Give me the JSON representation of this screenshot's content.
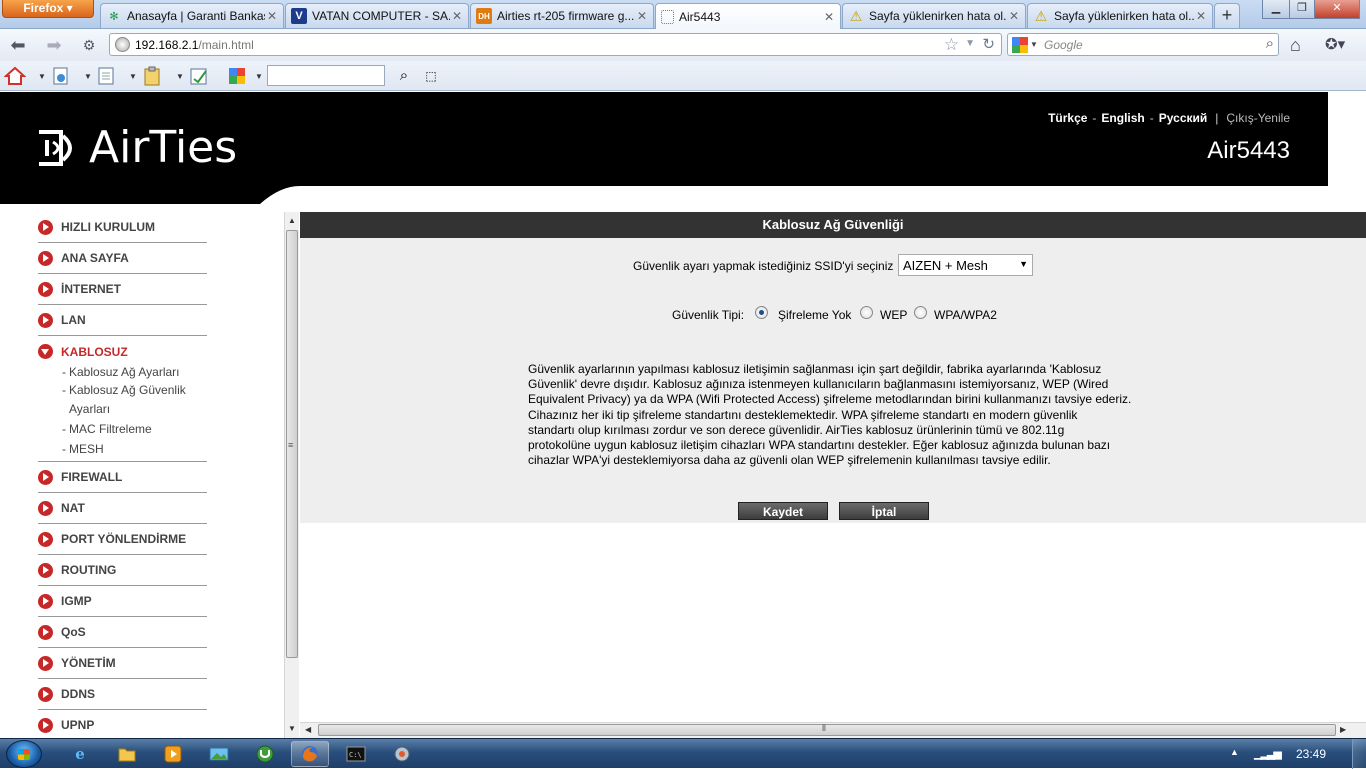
{
  "browser": {
    "app_button": "Firefox",
    "tabs": [
      {
        "title": "Anasayfa | Garanti Bankası",
        "icon": "garanti-icon"
      },
      {
        "title": "VATAN COMPUTER - SA...",
        "icon": "vatan-icon"
      },
      {
        "title": "Airties rt-205 firmware g...",
        "icon": "dh-icon"
      },
      {
        "title": "Air5443",
        "icon": "blank-page-icon",
        "active": true
      },
      {
        "title": "Sayfa yüklenirken hata ol...",
        "icon": "warning-icon"
      },
      {
        "title": "Sayfa yüklenirken hata ol...",
        "icon": "warning-icon"
      }
    ],
    "url_host": "192.168.2.1",
    "url_path": "/main.html",
    "search_placeholder": "Google",
    "icons": {
      "back": "◀",
      "forward": "▶",
      "home": "⌂",
      "bookmarks": "★"
    }
  },
  "header": {
    "logo": "AirTies",
    "lang": {
      "tr": "Türkçe",
      "en": "English",
      "ru": "Русский"
    },
    "sep": "-",
    "bar": "|",
    "logout": "Çıkış",
    "refresh": "Yenile",
    "model": "Air5443"
  },
  "menu": [
    {
      "label": "HIZLI KURULUM"
    },
    {
      "label": "ANA SAYFA"
    },
    {
      "label": "İNTERNET"
    },
    {
      "label": "LAN"
    },
    {
      "label": "KABLOSUZ",
      "active": true
    },
    {
      "label": "FIREWALL"
    },
    {
      "label": "NAT"
    },
    {
      "label": "PORT YÖNLENDİRME"
    },
    {
      "label": "ROUTING"
    },
    {
      "label": "IGMP"
    },
    {
      "label": "QoS"
    },
    {
      "label": "YÖNETİM"
    },
    {
      "label": "DDNS"
    },
    {
      "label": "UPNP"
    }
  ],
  "submenu": [
    {
      "label": "Kablosuz Ağ Ayarları"
    },
    {
      "label": "Kablosuz Ağ Güvenlik Ayarları"
    },
    {
      "label": "MAC Filtreleme"
    },
    {
      "label": "MESH"
    }
  ],
  "content": {
    "title": "Kablosuz Ağ Güvenliği",
    "ssid_label": "Güvenlik ayarı yapmak istediğiniz SSID'yi seçiniz",
    "ssid_value": "AIZEN + Mesh",
    "security_type_label": "Güvenlik Tipi:",
    "security_options": [
      {
        "label": "Şifreleme Yok",
        "checked": true
      },
      {
        "label": "WEP",
        "checked": false
      },
      {
        "label": "WPA/WPA2",
        "checked": false
      }
    ],
    "info_lines": [
      "Güvenlik ayarlarının yapılması kablosuz iletişimin sağlanması için şart değildir, fabrika ayarlarında 'Kablosuz",
      "Güvenlik' devre dışıdır. Kablosuz ağınıza istenmeyen kullanıcıların bağlanmasını istemiyorsanız, WEP (Wired",
      "Equivalent Privacy) ya da WPA (Wifi Protected Access) şifreleme metodlarından birini kullanmanızı tavsiye ederiz.",
      "Cihazınız her iki tip şifreleme standartını desteklemektedir. WPA şifreleme standartı en modern güvenlik",
      "standartı olup kırılması zordur ve son derece güvenlidir. AirTies kablosuz ürünlerinin tümü ve 802.11g",
      "protokolüne uygun kablosuz iletişim cihazları WPA standartını destekler. Eğer kablosuz ağınızda bulunan bazı",
      "cihazlar WPA'yi desteklemiyorsa daha az güvenli olan WEP şifrelemenin kullanılması tavsiye edilir."
    ],
    "save_label": "Kaydet",
    "cancel_label": "İptal"
  },
  "taskbar": {
    "clock": "23:49"
  }
}
